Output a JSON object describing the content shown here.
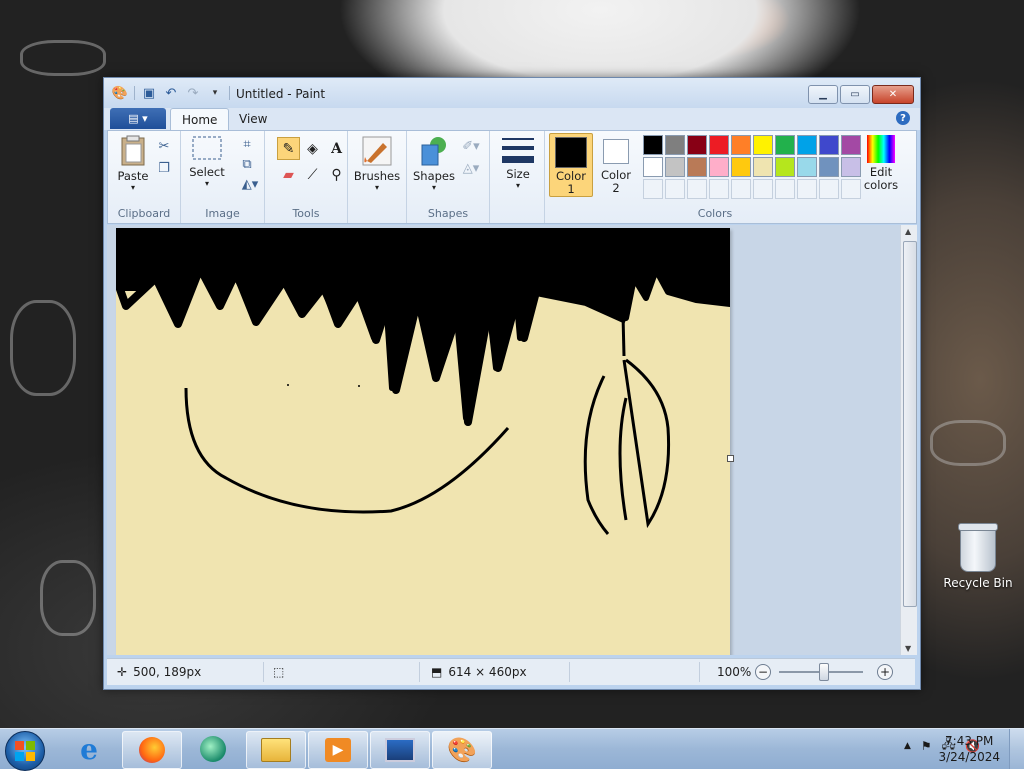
{
  "window": {
    "title": "Untitled - Paint"
  },
  "tabs": {
    "home": "Home",
    "view": "View"
  },
  "ribbon": {
    "clipboard": {
      "label": "Clipboard",
      "paste": "Paste"
    },
    "image": {
      "label": "Image",
      "select": "Select"
    },
    "tools": {
      "label": "Tools"
    },
    "brushes": "Brushes",
    "shapes": {
      "label": "Shapes",
      "shapes_btn": "Shapes"
    },
    "size": "Size",
    "color1": {
      "line1": "Color",
      "line2": "1"
    },
    "color2": {
      "line1": "Color",
      "line2": "2"
    },
    "colors": {
      "label": "Colors",
      "edit_line1": "Edit",
      "edit_line2": "colors"
    },
    "palette_row1": [
      "#000000",
      "#7f7f7f",
      "#880015",
      "#ed1c24",
      "#ff7f27",
      "#fff200",
      "#22b14c",
      "#00a2e8",
      "#3f48cc",
      "#a349a4"
    ],
    "palette_row2": [
      "#ffffff",
      "#c3c3c3",
      "#b97a57",
      "#ffaec9",
      "#ffc90e",
      "#efe4b0",
      "#b5e61d",
      "#99d9ea",
      "#7092be",
      "#c8bfe7"
    ]
  },
  "status": {
    "cursor_pos": "500, 189px",
    "image_size": "614 × 460px",
    "zoom": "100%"
  },
  "desktop": {
    "recycle_bin": "Recycle Bin"
  },
  "taskbar": {
    "time": "7:43 PM",
    "date": "3/24/2024"
  }
}
